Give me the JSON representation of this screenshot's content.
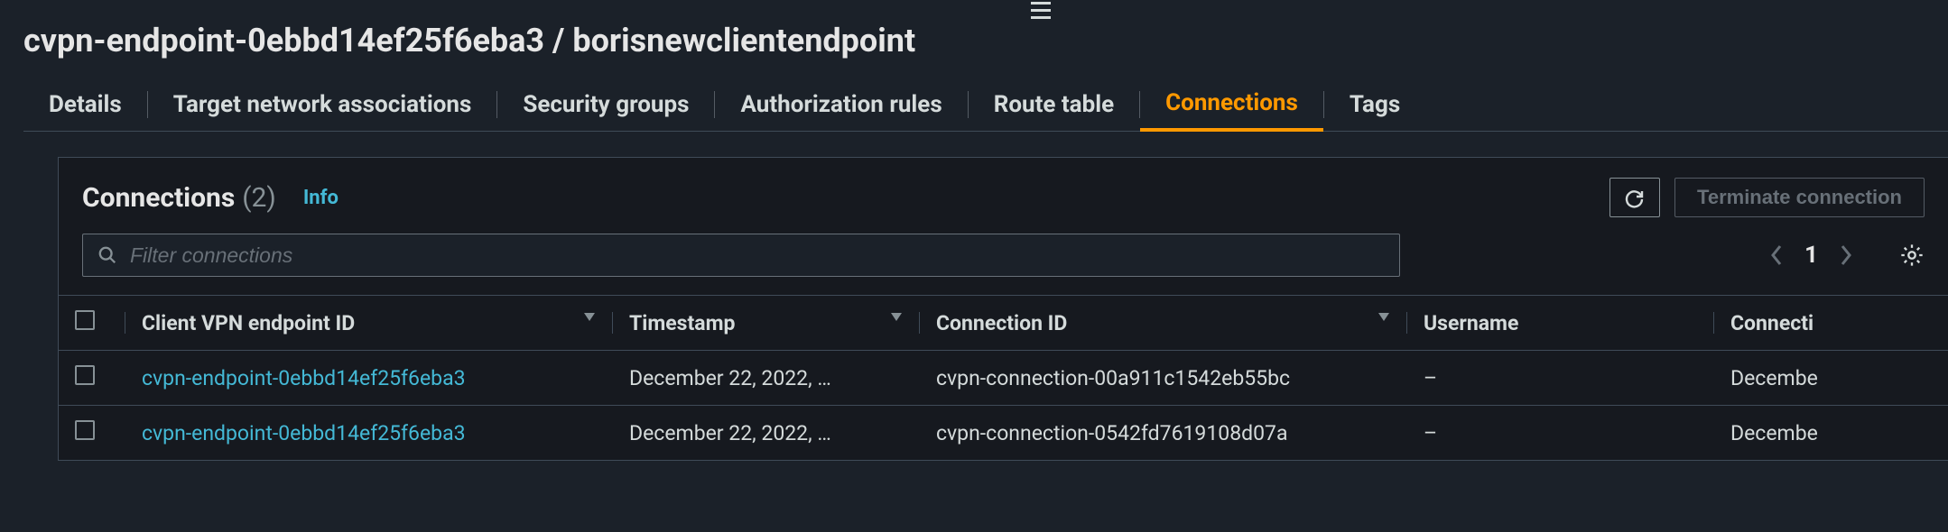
{
  "header": {
    "hamburger": "hamburger-icon",
    "title": "cvpn-endpoint-0ebbd14ef25f6eba3 / borisnewclientendpoint"
  },
  "tabs": [
    {
      "label": "Details",
      "active": false
    },
    {
      "label": "Target network associations",
      "active": false
    },
    {
      "label": "Security groups",
      "active": false
    },
    {
      "label": "Authorization rules",
      "active": false
    },
    {
      "label": "Route table",
      "active": false
    },
    {
      "label": "Connections",
      "active": true
    },
    {
      "label": "Tags",
      "active": false
    }
  ],
  "panel": {
    "title": "Connections",
    "count": "(2)",
    "info_label": "Info",
    "refresh_icon": "refresh-icon",
    "terminate_label": "Terminate connection",
    "search_placeholder": "Filter connections",
    "pager": {
      "page": "1"
    },
    "columns": [
      "Client VPN endpoint ID",
      "Timestamp",
      "Connection ID",
      "Username",
      "Connecti"
    ],
    "rows": [
      {
        "endpoint_id": "cvpn-endpoint-0ebbd14ef25f6eba3",
        "timestamp": "December 22, 2022, …",
        "connection_id": "cvpn-connection-00a911c1542eb55bc",
        "username": "–",
        "conn_est": "Decembe"
      },
      {
        "endpoint_id": "cvpn-endpoint-0ebbd14ef25f6eba3",
        "timestamp": "December 22, 2022, …",
        "connection_id": "cvpn-connection-0542fd7619108d07a",
        "username": "–",
        "conn_est": "Decembe"
      }
    ]
  }
}
